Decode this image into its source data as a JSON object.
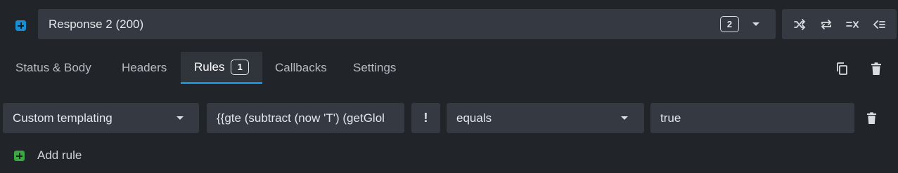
{
  "response_bar": {
    "label": "Response 2 (200)",
    "count": "2",
    "tools": [
      {
        "name": "shuffle-icon"
      },
      {
        "name": "repeat-icon"
      },
      {
        "name": "clear-rules-icon"
      },
      {
        "name": "rules-list-icon"
      }
    ]
  },
  "tabs": [
    {
      "label": "Status & Body"
    },
    {
      "label": "Headers"
    },
    {
      "label": "Rules",
      "badge": "1",
      "active": true
    },
    {
      "label": "Callbacks"
    },
    {
      "label": "Settings"
    }
  ],
  "rule": {
    "target": "Custom templating",
    "value": "{{gte (subtract (now 'T') (getGlol",
    "negate": "!",
    "operator": "equals",
    "expected": "true"
  },
  "add_rule": {
    "label": "Add rule"
  },
  "colors": {
    "background": "#212429",
    "field": "#353a42",
    "accent_blue": "#1590d6",
    "accent_green": "#3aa843"
  }
}
